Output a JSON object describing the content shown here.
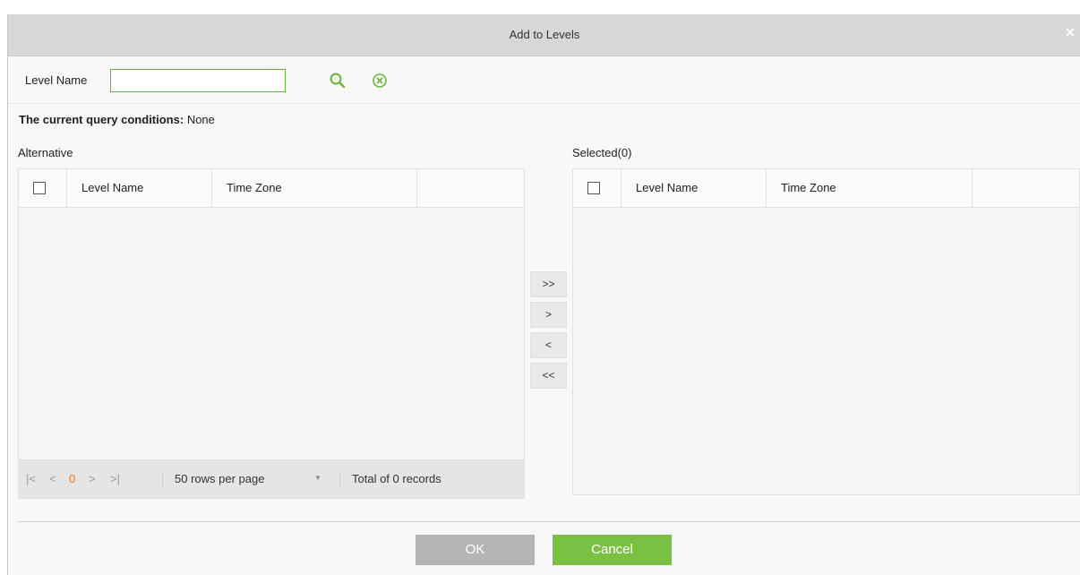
{
  "dialog": {
    "title": "Add to Levels",
    "close_glyph": "×"
  },
  "search": {
    "label": "Level Name",
    "value": "",
    "placeholder": "",
    "search_icon": "search-icon",
    "clear_icon": "clear-icon"
  },
  "query": {
    "prefix": "The current query conditions:",
    "value": "None"
  },
  "alternative": {
    "label": "Alternative",
    "columns": [
      "Level Name",
      "Time Zone"
    ],
    "pager": {
      "first": "|<",
      "prev": "<",
      "page": "0",
      "next": ">",
      "last": ">|",
      "rows_per_page": "50 rows per page",
      "dropdown_arrow": "▼",
      "total": "Total of 0 records"
    }
  },
  "selected": {
    "label": "Selected(0)",
    "columns": [
      "Level Name",
      "Time Zone"
    ]
  },
  "movers": {
    "add_all": ">>",
    "add": ">",
    "remove": "<",
    "remove_all": "<<"
  },
  "footer": {
    "ok_label": "OK",
    "cancel_label": "Cancel"
  },
  "colors": {
    "accent_green": "#7ac143",
    "disabled_gray": "#b5b5b5",
    "page_number": "#e87722"
  }
}
